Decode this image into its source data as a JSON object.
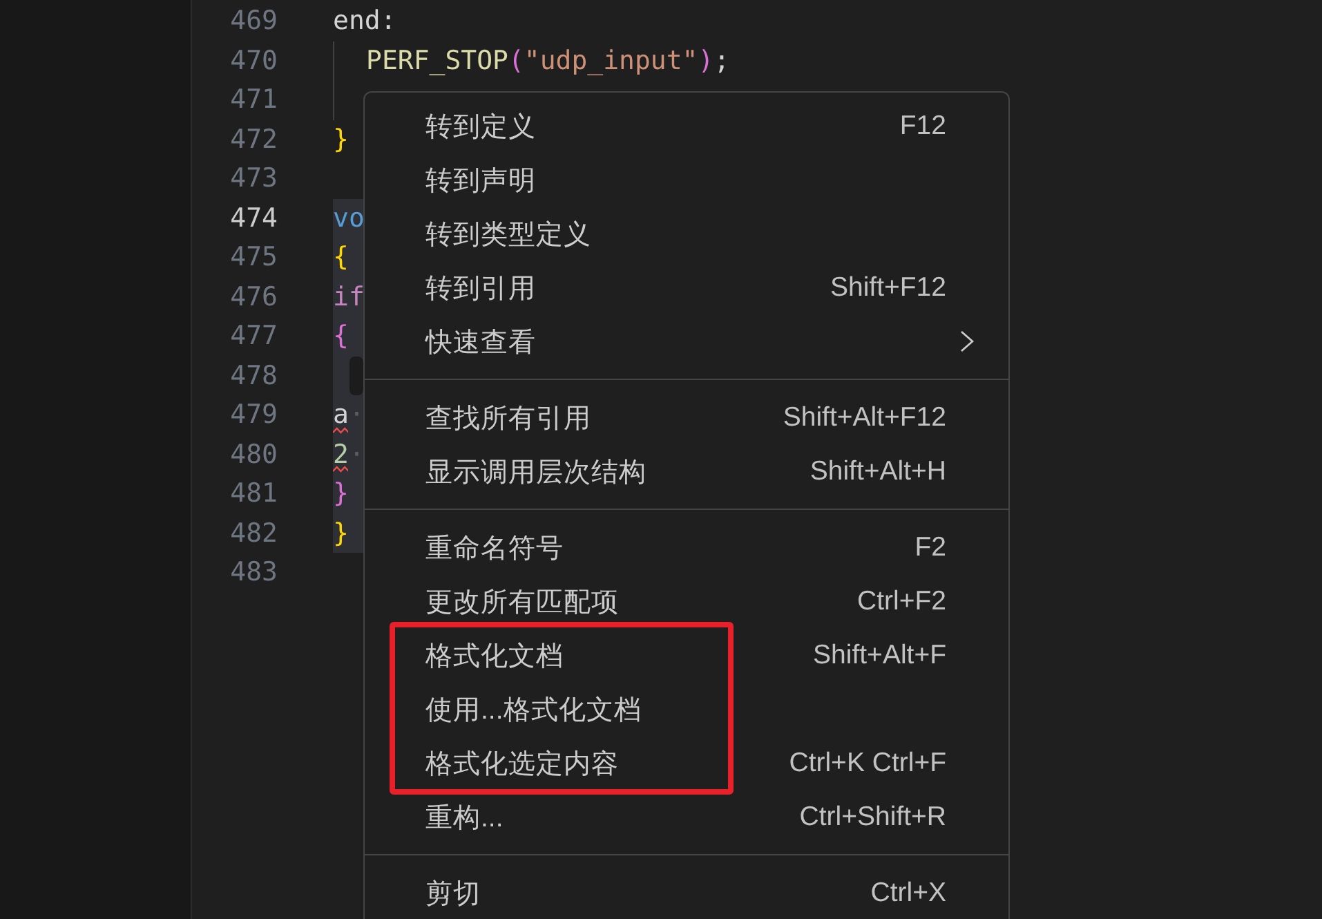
{
  "editor": {
    "lines": [
      {
        "number": "469",
        "current": false,
        "highlighted": false,
        "marker": false,
        "tokens": [
          {
            "text": "end:",
            "kind": "plain",
            "error": false
          }
        ],
        "children": [
          {
            "number": "470",
            "current": false,
            "highlighted": false,
            "marker": false,
            "tokens": [
              {
                "text": "PERF_STOP",
                "kind": "function",
                "error": false
              },
              {
                "text": "(",
                "kind": "bracket2",
                "error": false
              },
              {
                "text": "\"udp_input\"",
                "kind": "string",
                "error": false
              },
              {
                "text": ")",
                "kind": "bracket2",
                "error": false
              },
              {
                "text": ";",
                "kind": "plain",
                "error": false
              }
            ]
          },
          {
            "number": "471",
            "current": false,
            "highlighted": false,
            "marker": false
          }
        ]
      },
      {
        "number": "472",
        "current": false,
        "highlighted": false,
        "marker": false,
        "tokens": [
          {
            "text": "}",
            "kind": "bracket1",
            "error": false
          }
        ]
      },
      {
        "number": "473",
        "current": false,
        "highlighted": false,
        "marker": false
      },
      {
        "number": "474",
        "current": true,
        "highlighted": true,
        "marker": false,
        "tokens": [
          {
            "text": "vo",
            "kind": "type",
            "error": false
          }
        ]
      },
      {
        "number": "475",
        "current": false,
        "highlighted": true,
        "marker": false,
        "tokens": [
          {
            "text": "{",
            "kind": "bracket1",
            "error": false
          }
        ]
      },
      {
        "number": "476",
        "current": false,
        "highlighted": true,
        "marker": false,
        "tokens": [
          {
            "text": "if",
            "kind": "control",
            "error": false
          }
        ]
      },
      {
        "number": "477",
        "current": false,
        "highlighted": true,
        "marker": false,
        "tokens": [
          {
            "text": "{",
            "kind": "bracket2",
            "error": false
          }
        ]
      },
      {
        "number": "478",
        "current": false,
        "highlighted": true,
        "marker": true
      },
      {
        "number": "479",
        "current": false,
        "highlighted": true,
        "marker": false,
        "tokens": [
          {
            "text": "a",
            "kind": "plain",
            "error": true
          },
          {
            "text": "·",
            "kind": "whitespace",
            "error": false
          }
        ]
      },
      {
        "number": "480",
        "current": false,
        "highlighted": true,
        "marker": false,
        "tokens": [
          {
            "text": "2",
            "kind": "number",
            "error": true
          },
          {
            "text": "·",
            "kind": "whitespace",
            "error": false
          }
        ]
      },
      {
        "number": "481",
        "current": false,
        "highlighted": true,
        "marker": false,
        "tokens": [
          {
            "text": "}",
            "kind": "bracket2",
            "error": false
          }
        ]
      },
      {
        "number": "482",
        "current": false,
        "highlighted": true,
        "marker": false,
        "tokens": [
          {
            "text": "}",
            "kind": "bracket1",
            "error": false
          }
        ]
      },
      {
        "number": "483",
        "current": false,
        "highlighted": false,
        "marker": false
      }
    ]
  },
  "context_menu": {
    "groups": [
      {
        "items": [
          {
            "label": "转到定义",
            "shortcut": "F12",
            "submenu": false
          },
          {
            "label": "转到声明",
            "submenu": false
          },
          {
            "label": "转到类型定义",
            "submenu": false
          },
          {
            "label": "转到引用",
            "shortcut": "Shift+F12",
            "submenu": false
          },
          {
            "label": "快速查看",
            "submenu": true
          }
        ]
      },
      {
        "items": [
          {
            "label": "查找所有引用",
            "shortcut": "Shift+Alt+F12",
            "submenu": false
          },
          {
            "label": "显示调用层次结构",
            "shortcut": "Shift+Alt+H",
            "submenu": false
          }
        ]
      },
      {
        "items": [
          {
            "label": "重命名符号",
            "shortcut": "F2",
            "submenu": false
          },
          {
            "label": "更改所有匹配项",
            "shortcut": "Ctrl+F2",
            "submenu": false
          },
          {
            "label": "格式化文档",
            "shortcut": "Shift+Alt+F",
            "submenu": false
          },
          {
            "label": "使用...格式化文档",
            "submenu": false
          },
          {
            "label": "格式化选定内容",
            "shortcut": "Ctrl+K Ctrl+F",
            "submenu": false
          },
          {
            "label": "重构...",
            "shortcut": "Ctrl+Shift+R",
            "submenu": false
          }
        ]
      },
      {
        "items": [
          {
            "label": "剪切",
            "shortcut": "Ctrl+X",
            "submenu": false
          }
        ]
      }
    ]
  },
  "annotation": {
    "kind": "rectangle"
  }
}
